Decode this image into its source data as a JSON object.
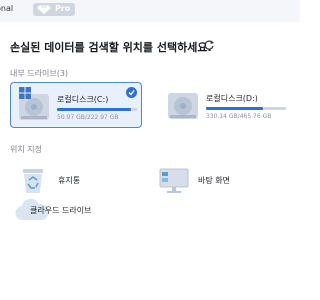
{
  "header": {
    "edition_label": "onal",
    "pro_badge": "Pro"
  },
  "main": {
    "title": "손실된 데이터를 검색할 위치를 선택하세요."
  },
  "internal_drives": {
    "label": "내부 드라이브(3)",
    "drives": [
      {
        "name": "로컬디스크(C:)",
        "size": "50.97 GB/222.97 GB",
        "used_fraction": 0.93,
        "selected": true
      },
      {
        "name": "로컬디스크(D:)",
        "size": "330.14 GB/465.76 GB",
        "used_fraction": 0.71,
        "selected": false
      }
    ]
  },
  "locations": {
    "label": "위치 지정",
    "items": [
      {
        "label": "휴지통"
      },
      {
        "label": "바탕 화면"
      },
      {
        "label": "클라우드 드라이브"
      }
    ]
  },
  "colors": {
    "accent": "#2e6fd8",
    "selected_bg": "#e8f0fc",
    "track": "#cfd6df",
    "topbar": "#f4f6f9"
  }
}
